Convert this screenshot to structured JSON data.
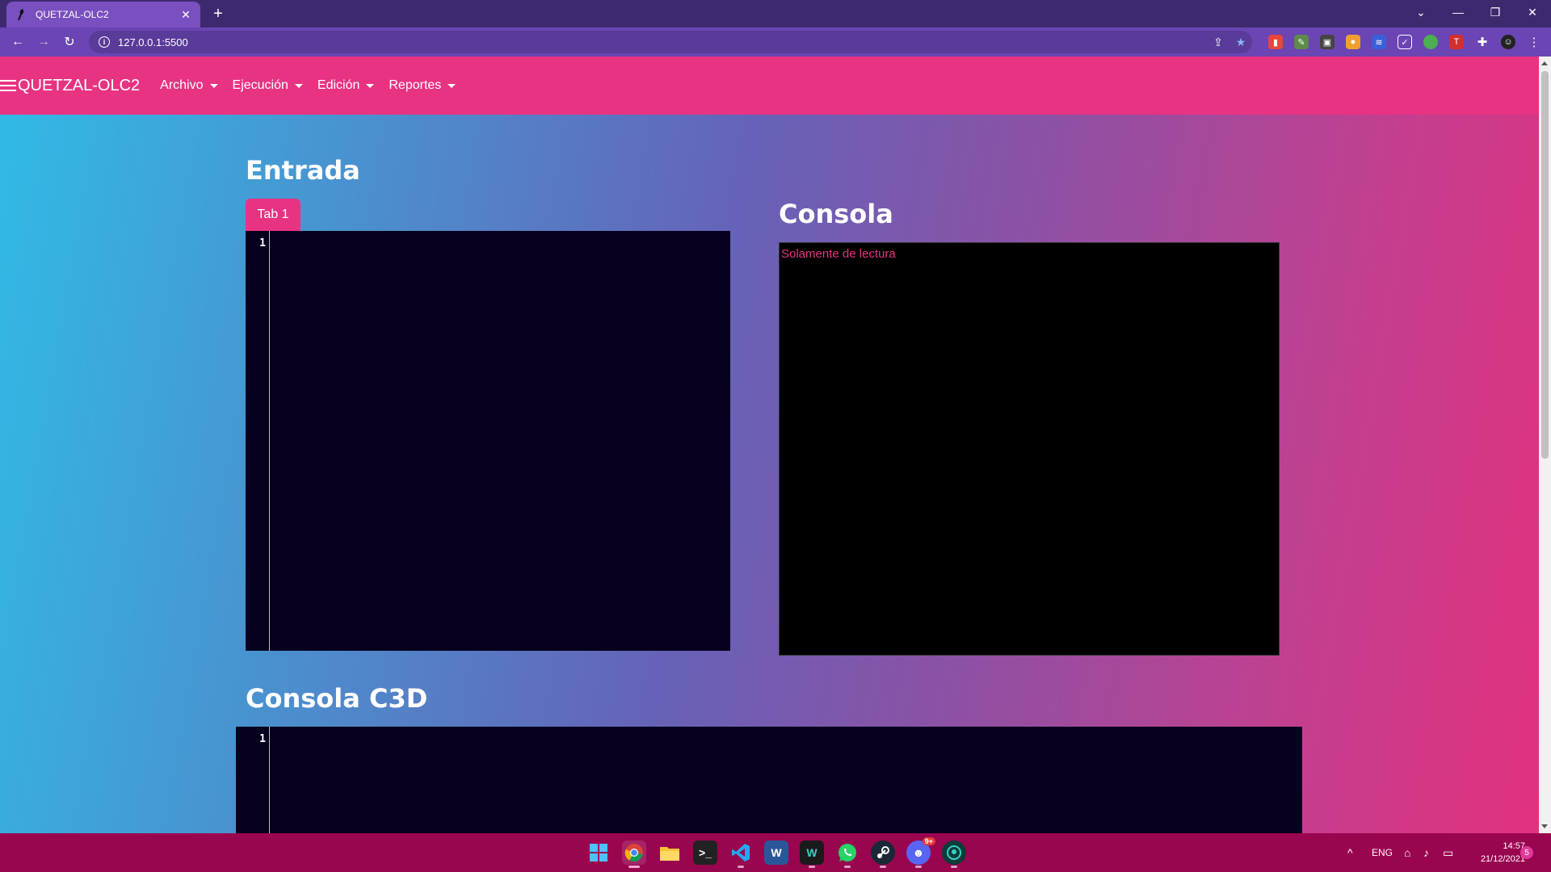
{
  "browser": {
    "tab_title": "QUETZAL-OLC2",
    "tab_close": "✕",
    "new_tab": "+",
    "url": "127.0.0.1:5500"
  },
  "app": {
    "brand": "QUETZAL-OLC2",
    "menu": [
      {
        "label": "Archivo"
      },
      {
        "label": "Ejecución"
      },
      {
        "label": "Edición"
      },
      {
        "label": "Reportes"
      }
    ]
  },
  "entrada": {
    "heading": "Entrada",
    "tab_label": "Tab 1",
    "line_number": "1"
  },
  "consola": {
    "heading": "Consola",
    "placeholder": "Solamente de lectura"
  },
  "c3d": {
    "heading": "Consola C3D",
    "line_number": "1"
  },
  "taskbar": {
    "language": "ENG",
    "time": "14:57",
    "date": "21/12/2021",
    "notification_count": "5",
    "discord_badge": "9+"
  },
  "colors": {
    "nav_pink": "#e83383",
    "editor_bg": "#07001f",
    "taskbar": "#9a0550",
    "browser_tab": "#7a4fbf"
  }
}
